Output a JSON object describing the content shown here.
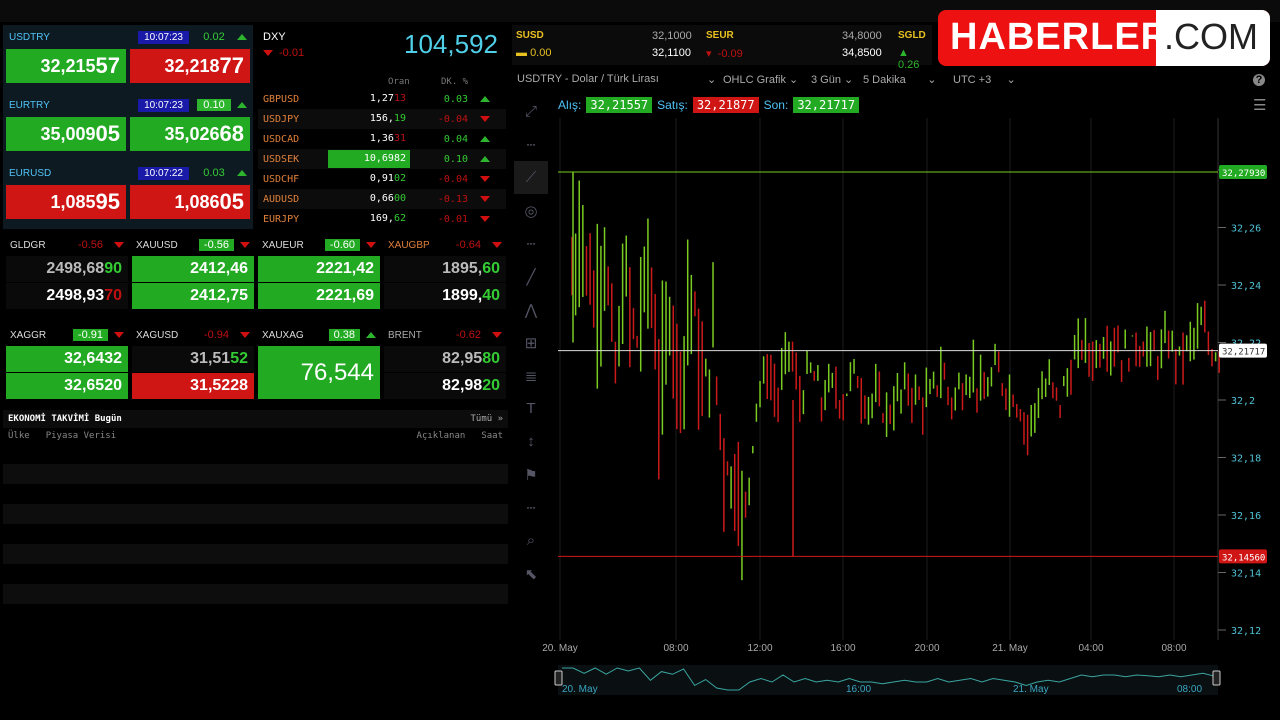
{
  "fx": [
    {
      "sym": "USDTRY",
      "time": "10:07:23",
      "chg": "0.02",
      "chg_box": false,
      "dir": "up",
      "bid": "32,215",
      "bid_big": "57",
      "bid_color": "g",
      "ask": "32,218",
      "ask_big": "77",
      "ask_color": "r"
    },
    {
      "sym": "EURTRY",
      "time": "10:07:23",
      "chg": "0.10",
      "chg_box": true,
      "dir": "up",
      "bid": "35,009",
      "bid_big": "05",
      "bid_color": "g",
      "ask": "35,026",
      "ask_big": "68",
      "ask_color": "g"
    },
    {
      "sym": "EURUSD",
      "time": "10:07:22",
      "chg": "0.03",
      "chg_box": false,
      "dir": "up",
      "bid": "1,085",
      "bid_big": "95",
      "bid_color": "r",
      "ask": "1,086",
      "ask_big": "05",
      "ask_color": "r"
    }
  ],
  "dxy": {
    "name": "DXY",
    "chg": "-0.01",
    "value": "104,592",
    "col_rate": "Oran",
    "col_chg": "DK. %"
  },
  "crosses": [
    {
      "sym": "GBPUSD",
      "rate": "1,27",
      "rate_tail": "13",
      "chg": "0.03",
      "dir": "up",
      "hl": false
    },
    {
      "sym": "USDJPY",
      "rate": "156,",
      "rate_tail": "19",
      "chg": "-0.04",
      "dir": "dn",
      "hl": false
    },
    {
      "sym": "USDCAD",
      "rate": "1,36",
      "rate_tail": "31",
      "chg": "0.04",
      "dir": "up",
      "hl": false
    },
    {
      "sym": "USDSEK",
      "rate": "10,6982",
      "rate_tail": "",
      "chg": "0.10",
      "dir": "up",
      "hl": true
    },
    {
      "sym": "USDCHF",
      "rate": "0,91",
      "rate_tail": "02",
      "chg": "-0.04",
      "dir": "dn",
      "hl": false
    },
    {
      "sym": "AUDUSD",
      "rate": "0,66",
      "rate_tail": "00",
      "chg": "-0.13",
      "dir": "dn",
      "hl": false
    },
    {
      "sym": "EURJPY",
      "rate": "169,",
      "rate_tail": "62",
      "chg": "-0.01",
      "dir": "dn",
      "hl": false
    }
  ],
  "metals": [
    {
      "sym": "GLDGR",
      "chg": "-0.56",
      "box": false,
      "dir": "dn",
      "v1": "2498,68",
      "t1": "90",
      "v2": "2498,93",
      "t2": "70",
      "c1": "k",
      "c2": "k"
    },
    {
      "sym": "XAUUSD",
      "chg": "-0.56",
      "box": true,
      "dir": "dn",
      "v1": "2412,46",
      "t1": "",
      "v2": "2412,75",
      "t2": "",
      "c1": "g",
      "c2": "g"
    },
    {
      "sym": "XAUEUR",
      "chg": "-0.60",
      "box": true,
      "dir": "dn",
      "v1": "2221,42",
      "t1": "",
      "v2": "2221,69",
      "t2": "",
      "c1": "g",
      "c2": "g"
    },
    {
      "sym": "XAUGBP",
      "chg": "-0.64",
      "box": false,
      "dir": "dn",
      "v1": "1895,",
      "t1": "60",
      "v2": "1899,",
      "t2": "40",
      "c1": "k",
      "c2": "k"
    },
    {
      "sym": "XAGGR",
      "chg": "-0.91",
      "box": true,
      "dir": "dn",
      "v1": "32,6432",
      "t1": "",
      "v2": "32,6520",
      "t2": "",
      "c1": "g",
      "c2": "g"
    },
    {
      "sym": "XAGUSD",
      "chg": "-0.94",
      "box": false,
      "dir": "dn",
      "v1": "31,51",
      "t1": "52",
      "v2": "31,5228",
      "t2": "",
      "c1": "k",
      "c2": "r"
    },
    {
      "sym": "XAUXAG",
      "chg": "0.38",
      "box": true,
      "dir": "up",
      "v1": "76,544",
      "t1": "",
      "v2": "",
      "t2": "",
      "c1": "g",
      "c2": "g"
    },
    {
      "sym": "BRENT",
      "chg": "-0.62",
      "box": false,
      "dir": "dn",
      "v1": "82,95",
      "t1": "80",
      "v2": "82,98",
      "t2": "20",
      "c1": "k",
      "c2": "k"
    }
  ],
  "calendar": {
    "title": "EKONOMİ TAKVİMİ",
    "today": "Bugün",
    "all": "Tümü »",
    "cols": [
      "Ülke",
      "Piyasa Verisi",
      "Açıklanan",
      "Saat"
    ]
  },
  "tickers": [
    {
      "sym": "SUSD",
      "chg": "0.00",
      "v1": "32,1000",
      "v2": "32,1100"
    },
    {
      "sym": "SEUR",
      "chg": "-0.09",
      "v1": "34,8000",
      "v2": "34,8500"
    },
    {
      "sym": "SGLD",
      "chg": "0.26"
    }
  ],
  "chart_header": {
    "instrument": "USDTRY - Dolar / Türk Lirası",
    "type": "OHLC Grafik",
    "range": "3 Gün",
    "interval": "5 Dakika",
    "tz": "UTC +3",
    "bid_label": "Alış:",
    "bid": "32,21557",
    "ask_label": "Satış:",
    "ask": "32,21877",
    "last_label": "Son:",
    "last": "32,21717"
  },
  "logo": {
    "a": "HABERLER",
    "b": ".COM"
  },
  "chart_data": {
    "type": "ohlc",
    "ylim": [
      32.12,
      32.28
    ],
    "yticks": [
      "32,12",
      "32,14",
      "32,16",
      "32,18",
      "32,2",
      "32,22",
      "32,24",
      "32,26",
      "32,28"
    ],
    "xticks": [
      "20. May",
      "08:00",
      "12:00",
      "16:00",
      "20:00",
      "21. May",
      "04:00",
      "08:00"
    ],
    "high_line": {
      "label": "32,27930",
      "value": 32.2793
    },
    "low_line": {
      "label": "32,14560",
      "value": 32.1456
    },
    "last_line": {
      "label": "32,21717",
      "value": 32.21717
    },
    "closes": [
      32.24,
      32.26,
      32.23,
      32.25,
      32.21,
      32.24,
      32.22,
      32.25,
      32.2,
      32.23,
      32.21,
      32.24,
      32.2,
      32.22,
      32.18,
      32.17,
      32.16,
      32.2,
      32.21,
      32.2,
      32.22,
      32.2,
      32.21,
      32.2,
      32.205,
      32.2,
      32.21,
      32.2,
      32.2,
      32.195,
      32.2,
      32.205,
      32.2,
      32.2,
      32.21,
      32.2,
      32.205,
      32.21,
      32.2,
      32.21,
      32.205,
      32.2,
      32.19,
      32.2,
      32.205,
      32.2,
      32.21,
      32.22,
      32.215,
      32.22,
      32.22,
      32.215,
      32.22,
      32.218,
      32.215,
      32.22,
      32.215,
      32.22,
      32.225,
      32.217
    ],
    "navigator_labels": [
      "20. May",
      "16:00",
      "21. May",
      "08:00"
    ]
  }
}
